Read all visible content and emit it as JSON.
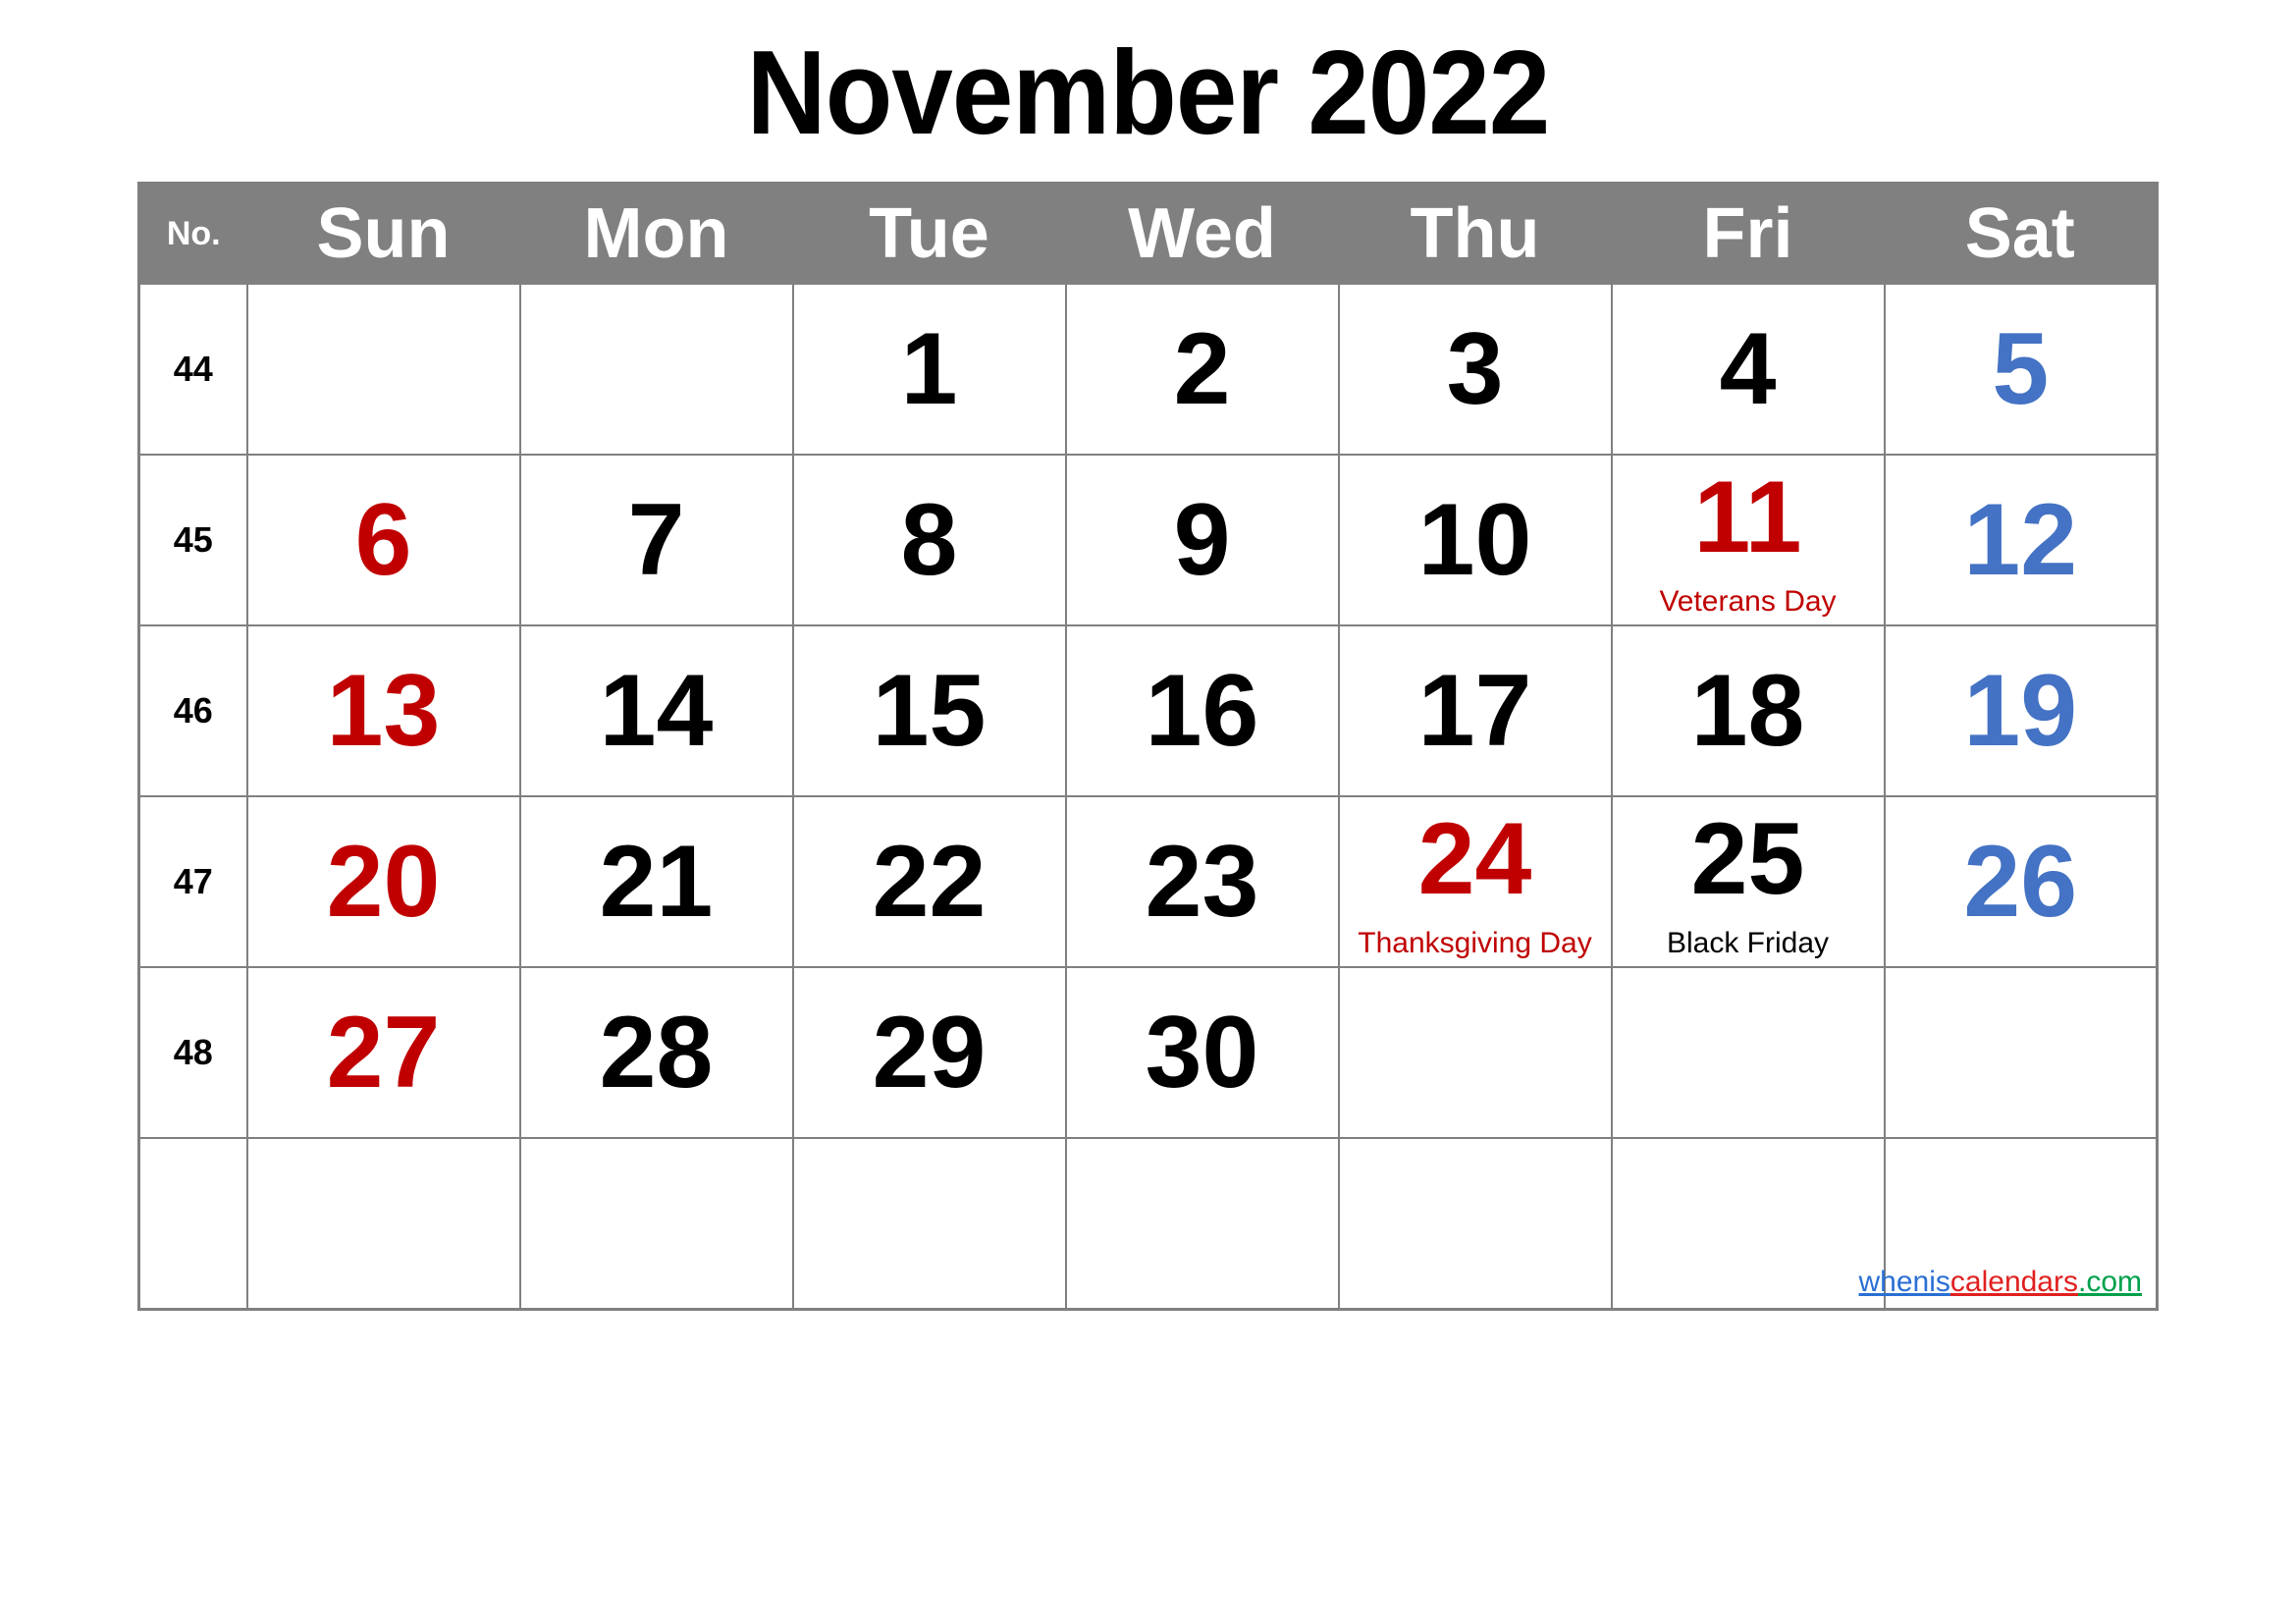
{
  "title": "November 2022",
  "header": {
    "week_col_label": "No.",
    "day_names": [
      "Sun",
      "Mon",
      "Tue",
      "Wed",
      "Thu",
      "Fri",
      "Sat"
    ]
  },
  "colors": {
    "header_bg": "#808080",
    "header_text": "#ffffff",
    "grid_line": "#808080",
    "sunday": "#C00000",
    "saturday": "#4472C4",
    "holiday": "#C00000",
    "weekday": "#000000"
  },
  "weeks": [
    {
      "number": "44",
      "days": [
        {
          "num": "",
          "note": "",
          "kind": "empty"
        },
        {
          "num": "",
          "note": "",
          "kind": "empty"
        },
        {
          "num": "1",
          "note": "",
          "kind": "weekday"
        },
        {
          "num": "2",
          "note": "",
          "kind": "weekday"
        },
        {
          "num": "3",
          "note": "",
          "kind": "weekday"
        },
        {
          "num": "4",
          "note": "",
          "kind": "weekday"
        },
        {
          "num": "5",
          "note": "",
          "kind": "sat"
        }
      ]
    },
    {
      "number": "45",
      "days": [
        {
          "num": "6",
          "note": "",
          "kind": "sun"
        },
        {
          "num": "7",
          "note": "",
          "kind": "weekday"
        },
        {
          "num": "8",
          "note": "",
          "kind": "weekday"
        },
        {
          "num": "9",
          "note": "",
          "kind": "weekday"
        },
        {
          "num": "10",
          "note": "",
          "kind": "weekday"
        },
        {
          "num": "11",
          "note": "Veterans Day",
          "kind": "holi",
          "note_color": "red"
        },
        {
          "num": "12",
          "note": "",
          "kind": "sat"
        }
      ]
    },
    {
      "number": "46",
      "days": [
        {
          "num": "13",
          "note": "",
          "kind": "sun"
        },
        {
          "num": "14",
          "note": "",
          "kind": "weekday"
        },
        {
          "num": "15",
          "note": "",
          "kind": "weekday"
        },
        {
          "num": "16",
          "note": "",
          "kind": "weekday"
        },
        {
          "num": "17",
          "note": "",
          "kind": "weekday"
        },
        {
          "num": "18",
          "note": "",
          "kind": "weekday"
        },
        {
          "num": "19",
          "note": "",
          "kind": "sat"
        }
      ]
    },
    {
      "number": "47",
      "days": [
        {
          "num": "20",
          "note": "",
          "kind": "sun"
        },
        {
          "num": "21",
          "note": "",
          "kind": "weekday"
        },
        {
          "num": "22",
          "note": "",
          "kind": "weekday"
        },
        {
          "num": "23",
          "note": "",
          "kind": "weekday"
        },
        {
          "num": "24",
          "note": "Thanksgiving Day",
          "kind": "holi",
          "note_color": "red"
        },
        {
          "num": "25",
          "note": "Black Friday",
          "kind": "weekday",
          "note_color": "black"
        },
        {
          "num": "26",
          "note": "",
          "kind": "sat"
        }
      ]
    },
    {
      "number": "48",
      "days": [
        {
          "num": "27",
          "note": "",
          "kind": "sun"
        },
        {
          "num": "28",
          "note": "",
          "kind": "weekday"
        },
        {
          "num": "29",
          "note": "",
          "kind": "weekday"
        },
        {
          "num": "30",
          "note": "",
          "kind": "weekday"
        },
        {
          "num": "",
          "note": "",
          "kind": "empty"
        },
        {
          "num": "",
          "note": "",
          "kind": "empty"
        },
        {
          "num": "",
          "note": "",
          "kind": "empty"
        }
      ]
    },
    {
      "number": "",
      "days": [
        {
          "num": "",
          "note": "",
          "kind": "empty"
        },
        {
          "num": "",
          "note": "",
          "kind": "empty"
        },
        {
          "num": "",
          "note": "",
          "kind": "empty"
        },
        {
          "num": "",
          "note": "",
          "kind": "empty"
        },
        {
          "num": "",
          "note": "",
          "kind": "empty"
        },
        {
          "num": "",
          "note": "",
          "kind": "empty"
        },
        {
          "num": "",
          "note": "",
          "kind": "empty"
        }
      ]
    }
  ],
  "watermark": {
    "part1": "whenis",
    "part2": "calendars",
    "part3": ".com"
  }
}
